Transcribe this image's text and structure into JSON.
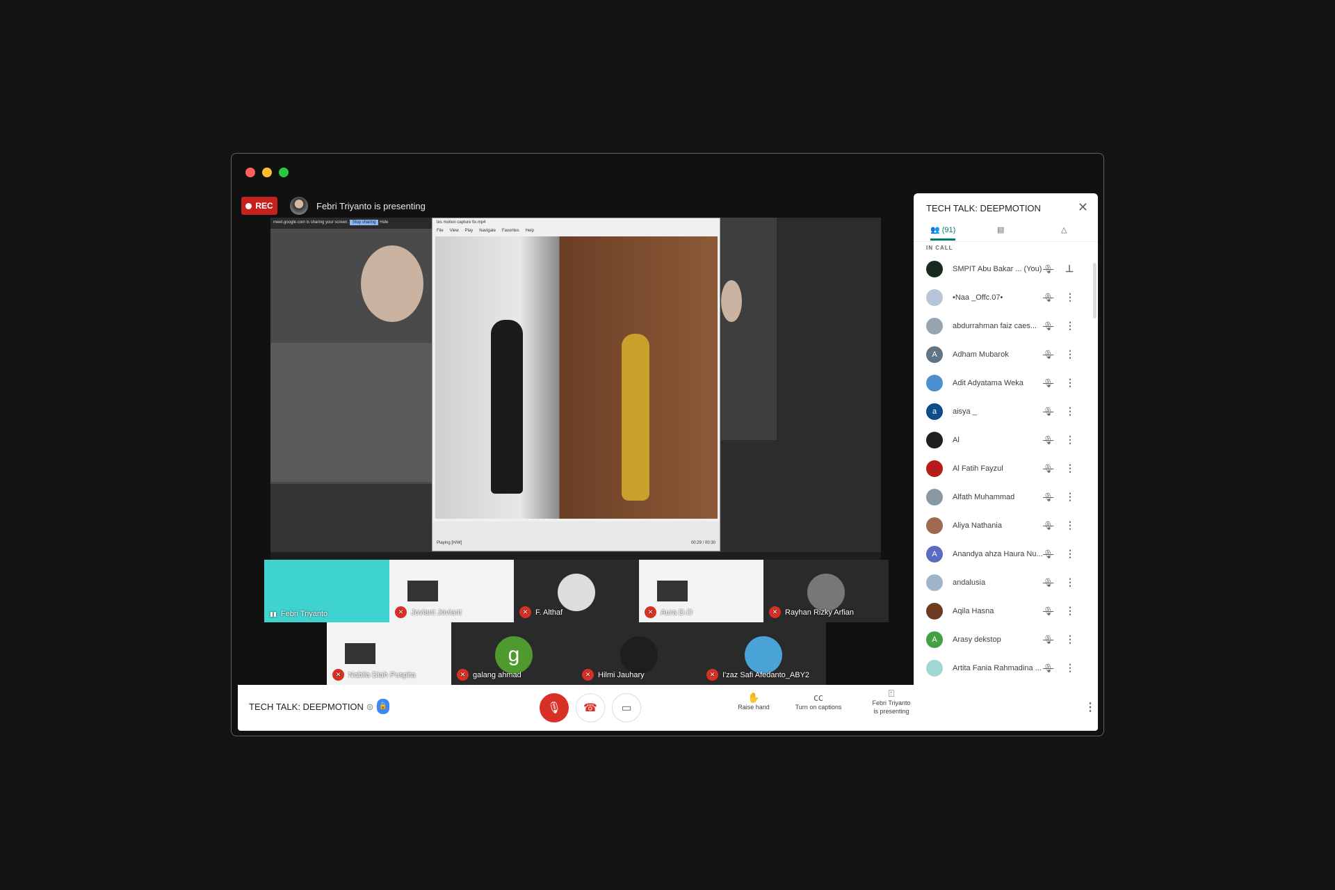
{
  "window": {
    "traffic_lights": [
      "#ff5f57",
      "#febc2e",
      "#28c840"
    ]
  },
  "header": {
    "rec_label": "REC",
    "presenting_text": "Febri Triyanto is presenting"
  },
  "shared_screen": {
    "sharing_banner": "meet.google.com is sharing your screen.",
    "stop_sharing": "Stop sharing",
    "hide": "Hide",
    "player_title": "tes motion capture fix.mp4",
    "player_menu": [
      "File",
      "View",
      "Play",
      "Navigate",
      "Favorites",
      "Help"
    ],
    "player_status": "Playing [H/W]",
    "player_time": "00:29 / 00:30"
  },
  "tiles": [
    {
      "name": "Febri Triyanto",
      "speaking": true,
      "bg": "#3fd3cf"
    },
    {
      "name": "Joviant Joviant",
      "muted": true,
      "slide": true
    },
    {
      "name": "F. Althaf",
      "muted": true,
      "avatar_bg": "#ddd"
    },
    {
      "name": "Aura D.O",
      "muted": true,
      "slide": true
    },
    {
      "name": "Rayhan Rizky Arfian",
      "muted": true,
      "avatar_bg": "#777"
    },
    {
      "name": "Nabila Diah Puspita",
      "muted": true,
      "slide": true
    },
    {
      "name": "galang ahmad",
      "muted": true,
      "avatar_bg": "#4f9a2f",
      "initial": "g"
    },
    {
      "name": "Hilmi Jauhary",
      "muted": true,
      "avatar_bg": "#1e1e1e"
    },
    {
      "name": "I'zaz Safi Afedanto_ABY2",
      "muted": true,
      "avatar_bg": "#4aa3d6"
    }
  ],
  "panel": {
    "title": "TECH TALK: DEEPMOTION",
    "people_count": "(91)",
    "section": "IN CALL",
    "participants": [
      {
        "name": "SMPIT Abu Bakar ...  (You)",
        "color": "#1b2a1f",
        "initial": "",
        "pinned": true
      },
      {
        "name": "•Naa _Offc.07•",
        "color": "#b7c6d6",
        "initial": ""
      },
      {
        "name": "abdurrahman faiz caes...",
        "color": "#98a4b0",
        "initial": ""
      },
      {
        "name": "Adham Mubarok",
        "color": "#5f7585",
        "initial": "A"
      },
      {
        "name": "Adit Adyatama Weka",
        "color": "#4c8fd1",
        "initial": ""
      },
      {
        "name": "aisya _",
        "color": "#0f4c8a",
        "initial": "a"
      },
      {
        "name": "Al",
        "color": "#202020",
        "initial": ""
      },
      {
        "name": "Al Fatih Fayzul",
        "color": "#b71c1c",
        "initial": ""
      },
      {
        "name": "Alfath Muhammad",
        "color": "#8a9aa5",
        "initial": ""
      },
      {
        "name": "Aliya Nathania",
        "color": "#a06a50",
        "initial": ""
      },
      {
        "name": "Anandya ahza Haura Nu...",
        "color": "#5c6bc0",
        "initial": "A"
      },
      {
        "name": "andalusia",
        "color": "#9fb4c8",
        "initial": ""
      },
      {
        "name": "Aqila Hasna",
        "color": "#6d3b20",
        "initial": ""
      },
      {
        "name": "Arasy dekstop",
        "color": "#43a047",
        "initial": "A"
      },
      {
        "name": "Artita Fania Rahmadina ...",
        "color": "#9ed8d0",
        "initial": ""
      }
    ]
  },
  "bottom_bar": {
    "meeting_title": "TECH TALK: DEEPMOTION",
    "raise_hand": "Raise hand",
    "captions": "Turn on captions",
    "presenting_line1": "Febri Triyanto",
    "presenting_line2": "is presenting",
    "mic_color": "#d93025"
  }
}
